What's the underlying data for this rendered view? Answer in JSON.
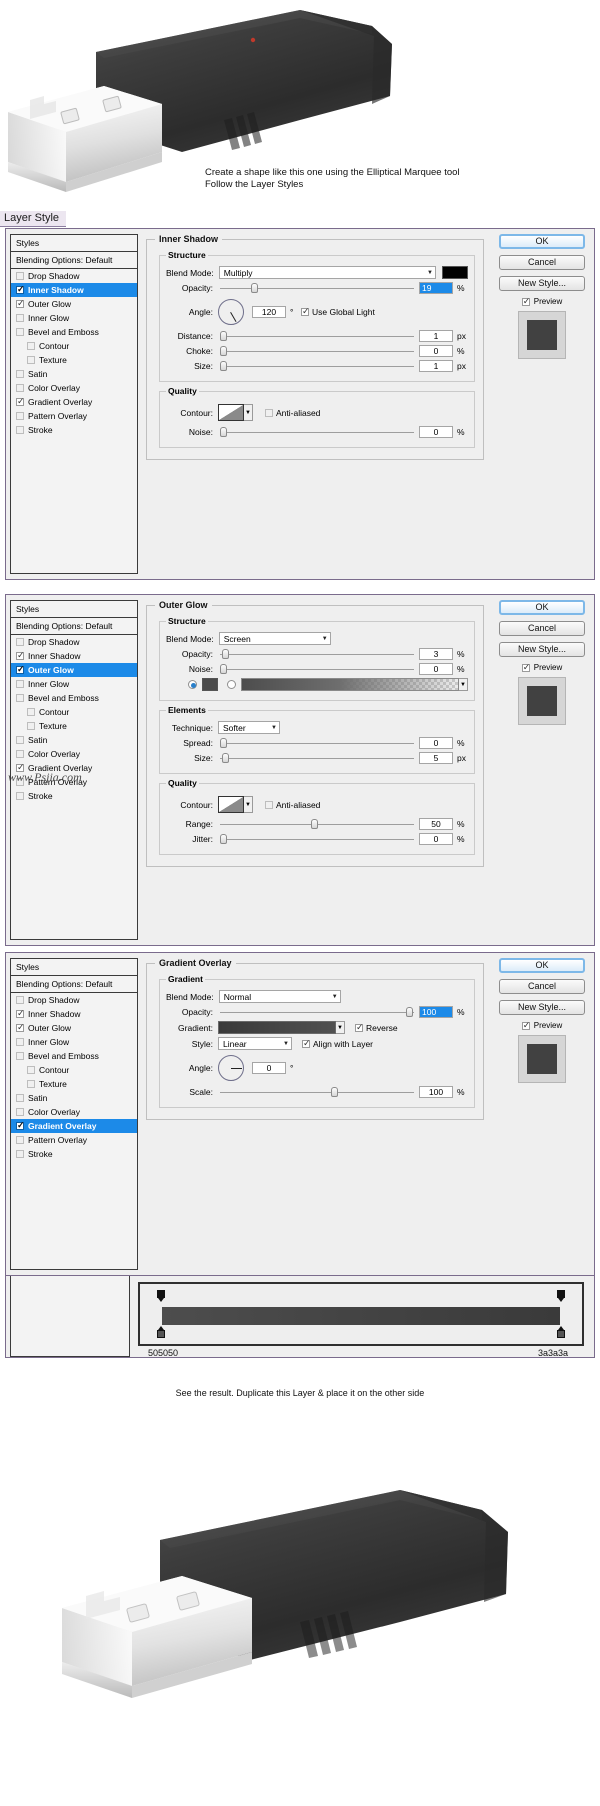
{
  "page": {
    "watermark": "www.Psjia.com",
    "layer_style_tab": "Layer Style",
    "caption_top_line1": "Create a shape like this one using the Elliptical Marquee tool",
    "caption_top_line2": "Follow the Layer Styles",
    "caption_bottom": "See the result. Duplicate this Layer & place it on the other side"
  },
  "styles_list": {
    "header": "Styles",
    "blending_options": "Blending Options: Default",
    "items": [
      {
        "label": "Drop Shadow",
        "checked": false,
        "indent": false
      },
      {
        "label": "Inner Shadow",
        "checked": true,
        "indent": false
      },
      {
        "label": "Outer Glow",
        "checked": true,
        "indent": false
      },
      {
        "label": "Inner Glow",
        "checked": false,
        "indent": false
      },
      {
        "label": "Bevel and Emboss",
        "checked": false,
        "indent": false
      },
      {
        "label": "Contour",
        "checked": false,
        "indent": true
      },
      {
        "label": "Texture",
        "checked": false,
        "indent": true
      },
      {
        "label": "Satin",
        "checked": false,
        "indent": false
      },
      {
        "label": "Color Overlay",
        "checked": false,
        "indent": false
      },
      {
        "label": "Gradient Overlay",
        "checked": true,
        "indent": false
      },
      {
        "label": "Pattern Overlay",
        "checked": false,
        "indent": false
      },
      {
        "label": "Stroke",
        "checked": false,
        "indent": false
      }
    ]
  },
  "buttons": {
    "ok": "OK",
    "cancel": "Cancel",
    "new_style": "New Style...",
    "preview": "Preview"
  },
  "dialog_inner_shadow": {
    "selected_style": "Inner Shadow",
    "title": "Inner Shadow",
    "structure_title": "Structure",
    "quality_title": "Quality",
    "blend_mode_label": "Blend Mode:",
    "blend_mode_value": "Multiply",
    "blend_color": "#000000",
    "opacity_label": "Opacity:",
    "opacity_value": "19",
    "opacity_unit": "%",
    "angle_label": "Angle:",
    "angle_value": "120",
    "angle_unit": "°",
    "use_global_light": "Use Global Light",
    "use_global_light_checked": true,
    "distance_label": "Distance:",
    "distance_value": "1",
    "distance_unit": "px",
    "choke_label": "Choke:",
    "choke_value": "0",
    "choke_unit": "%",
    "size_label": "Size:",
    "size_value": "1",
    "size_unit": "px",
    "contour_label": "Contour:",
    "anti_aliased": "Anti-aliased",
    "anti_aliased_checked": false,
    "noise_label": "Noise:",
    "noise_value": "0",
    "noise_unit": "%"
  },
  "dialog_outer_glow": {
    "selected_style": "Outer Glow",
    "title": "Outer Glow",
    "structure_title": "Structure",
    "elements_title": "Elements",
    "quality_title": "Quality",
    "blend_mode_label": "Blend Mode:",
    "blend_mode_value": "Screen",
    "opacity_label": "Opacity:",
    "opacity_value": "3",
    "opacity_unit": "%",
    "noise_label": "Noise:",
    "noise_value": "0",
    "noise_unit": "%",
    "color_mode_solid_selected": true,
    "glow_color": "#4a4a4a",
    "technique_label": "Technique:",
    "technique_value": "Softer",
    "spread_label": "Spread:",
    "spread_value": "0",
    "spread_unit": "%",
    "size_label": "Size:",
    "size_value": "5",
    "size_unit": "px",
    "contour_label": "Contour:",
    "anti_aliased": "Anti-aliased",
    "anti_aliased_checked": false,
    "range_label": "Range:",
    "range_value": "50",
    "range_unit": "%",
    "jitter_label": "Jitter:",
    "jitter_value": "0",
    "jitter_unit": "%"
  },
  "dialog_gradient_overlay": {
    "selected_style": "Gradient Overlay",
    "title": "Gradient Overlay",
    "gradient_title": "Gradient",
    "blend_mode_label": "Blend Mode:",
    "blend_mode_value": "Normal",
    "opacity_label": "Opacity:",
    "opacity_value": "100",
    "opacity_unit": "%",
    "gradient_label": "Gradient:",
    "reverse_label": "Reverse",
    "reverse_checked": true,
    "style_label": "Style:",
    "style_value": "Linear",
    "align_with_layer": "Align with Layer",
    "align_checked": true,
    "angle_label": "Angle:",
    "angle_value": "0",
    "angle_unit": "°",
    "scale_label": "Scale:",
    "scale_value": "100",
    "scale_unit": "%",
    "gradient_stop_left_hex": "505050",
    "gradient_stop_right_hex": "3a3a3a"
  }
}
